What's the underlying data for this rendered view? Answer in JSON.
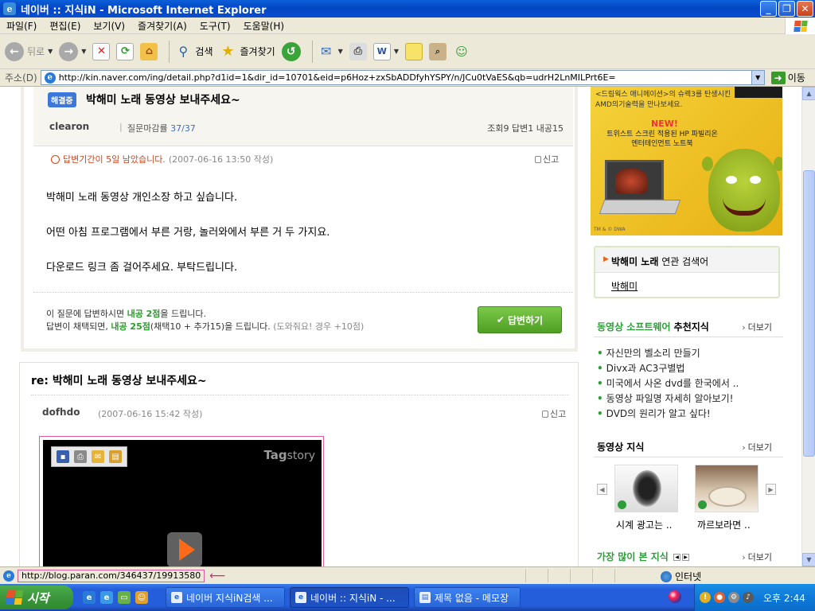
{
  "window": {
    "title": "네이버 :: 지식iN - Microsoft Internet Explorer",
    "app_icon": "e"
  },
  "menu": [
    "파일(F)",
    "편집(E)",
    "보기(V)",
    "즐겨찾기(A)",
    "도구(T)",
    "도움말(H)"
  ],
  "toolbar": {
    "back": "뒤로",
    "search": "검색",
    "favorites": "즐겨찾기"
  },
  "address": {
    "label": "주소(D)",
    "url": "http://kin.naver.com/ing/detail.php?d1id=1&dir_id=10701&eid=p6Hoz+zxSbADDfyhYSPY/n/JCu0tVaES&qb=udrH2LnMILPrt6E=",
    "go": "이동"
  },
  "question": {
    "badge": "해결중",
    "title": "박해미 노래 동영상 보내주세요~",
    "asker": "clearon",
    "separator": "|",
    "close_rate_label": "질문마감률",
    "close_rate_value": "37/37",
    "stats": "조회9  답변1  내공15",
    "deadline": "답변기간이 5일 남았습니다.",
    "deadline_date": "(2007-06-16 13:50 작성)",
    "report": "신고",
    "body": [
      "박해미 노래 동영상 개인소장 하고 싶습니다.",
      "어떤 아침 프로그램에서 부른 거랑, 놀러와에서 부른 거 두 가지요.",
      "다운로드 링크 좀 걸어주세요. 부탁드립니다."
    ],
    "reward_line1_pre": "이 질문에 답변하시면 ",
    "reward_line1_pts": "내공 2점",
    "reward_line1_post": "을 드립니다.",
    "reward_line2_pre": "답변이 채택되면, ",
    "reward_line2_pts": "내공 25점",
    "reward_line2_post": "(채택10 + 추가15)을 드립니다.",
    "reward_line2_note": "(도와줘요! 경우 +10점)",
    "answer_button": "답변하기"
  },
  "answer": {
    "title": "re: 박해미 노래 동영상 보내주세요~",
    "user": "dofhdo",
    "date": "(2007-06-16 15:42 작성)",
    "report": "신고",
    "player_logo_bold": "Tag",
    "player_logo_rest": "story"
  },
  "ad": {
    "text1": "<드림웍스 애니메이션>의 슈렉3를 탄생시킨 AMD의기술력을 만나보세요.",
    "new": "NEW!",
    "text2": "트위스트 스크린 적용된 HP 파빌리온 엔터테인먼트 노트북",
    "footer": "TM & © DWA"
  },
  "related": {
    "keyword": "박해미 노래",
    "suffix": " 연관 검색어",
    "item": "박해미"
  },
  "recommended": {
    "title_green": "동영상 소프트웨어",
    "title_rest": " 추천지식",
    "more": "더보기",
    "items": [
      "자신만의 벨소리 만들기",
      "Divx과 AC3구별법",
      "미국에서 사온 dvd를 한국에서 ..",
      "동영상 파일명 자세히 알아보기!",
      "DVD의 원리가 알고 싶다!"
    ]
  },
  "video_knowledge": {
    "title": "동영상 지식",
    "more": "더보기",
    "captions": [
      "시계 광고는 ..",
      "까르보라면 .."
    ]
  },
  "most_viewed": {
    "title": "가장 많이 본 지식",
    "more": "더보기"
  },
  "status": {
    "url": "http://blog.paran.com/346437/19913580",
    "zone": "인터넷"
  },
  "taskbar": {
    "start": "시작",
    "tasks": [
      "네이버 지식iN검색 ...",
      "네이버 :: 지식iN - ...",
      "제목 없음 - 메모장"
    ],
    "clock": "오후 2:44"
  },
  "colors": {
    "title_bar": "#0344c2",
    "naver_green": "#2e9c3a",
    "answer_button": "#4f9f24",
    "deadline": "#d0451f",
    "taskbar": "#245edb"
  }
}
